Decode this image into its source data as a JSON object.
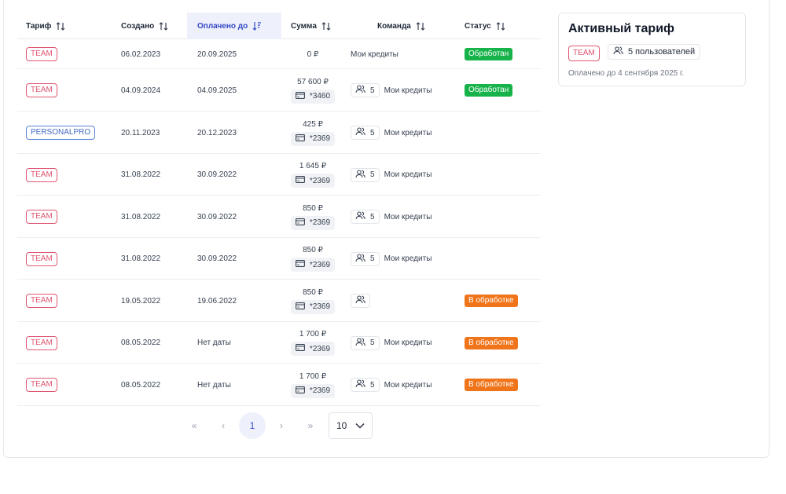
{
  "table": {
    "headers": {
      "tariff": "Тариф",
      "created": "Создано",
      "paid_until": "Оплачено до",
      "amount": "Сумма",
      "team": "Команда",
      "status": "Статус"
    },
    "rows": [
      {
        "tariff": "TEAM",
        "tariff_style": "team",
        "created": "06.02.2023",
        "paid_until": "20.09.2025",
        "amount": "0 ₽",
        "card": "",
        "team_count": "",
        "team_name": "Мои кредиты",
        "team_chip": false,
        "status": "Обработан",
        "status_color": "green"
      },
      {
        "tariff": "TEAM",
        "tariff_style": "team",
        "created": "04.09.2024",
        "paid_until": "04.09.2025",
        "amount": "57 600 ₽",
        "card": "*3460",
        "team_count": "5",
        "team_name": "Мои кредиты",
        "team_chip": true,
        "status": "Обработан",
        "status_color": "green"
      },
      {
        "tariff": "PERSONALPRO",
        "tariff_style": "pro",
        "created": "20.11.2023",
        "paid_until": "20.12.2023",
        "amount": "425 ₽",
        "card": "*2369",
        "team_count": "5",
        "team_name": "Мои кредиты",
        "team_chip": true,
        "status": "",
        "status_color": ""
      },
      {
        "tariff": "TEAM",
        "tariff_style": "team",
        "created": "31.08.2022",
        "paid_until": "30.09.2022",
        "amount": "1 645 ₽",
        "card": "*2369",
        "team_count": "5",
        "team_name": "Мои кредиты",
        "team_chip": true,
        "status": "",
        "status_color": ""
      },
      {
        "tariff": "TEAM",
        "tariff_style": "team",
        "created": "31.08.2022",
        "paid_until": "30.09.2022",
        "amount": "850 ₽",
        "card": "*2369",
        "team_count": "5",
        "team_name": "Мои кредиты",
        "team_chip": true,
        "status": "",
        "status_color": ""
      },
      {
        "tariff": "TEAM",
        "tariff_style": "team",
        "created": "31.08.2022",
        "paid_until": "30.09.2022",
        "amount": "850 ₽",
        "card": "*2369",
        "team_count": "5",
        "team_name": "Мои кредиты",
        "team_chip": true,
        "status": "",
        "status_color": ""
      },
      {
        "tariff": "TEAM",
        "tariff_style": "team",
        "created": "19.05.2022",
        "paid_until": "19.06.2022",
        "amount": "850 ₽",
        "card": "*2369",
        "team_count": "",
        "team_name": "",
        "team_chip": true,
        "status": "В обработке",
        "status_color": "orange"
      },
      {
        "tariff": "TEAM",
        "tariff_style": "team",
        "created": "08.05.2022",
        "paid_until": "Нет даты",
        "amount": "1 700 ₽",
        "card": "*2369",
        "team_count": "5",
        "team_name": "Мои кредиты",
        "team_chip": true,
        "status": "В обработке",
        "status_color": "orange"
      },
      {
        "tariff": "TEAM",
        "tariff_style": "team",
        "created": "08.05.2022",
        "paid_until": "Нет даты",
        "amount": "1 700 ₽",
        "card": "*2369",
        "team_count": "5",
        "team_name": "Мои кредиты",
        "team_chip": true,
        "status": "В обработке",
        "status_color": "orange"
      }
    ]
  },
  "pagination": {
    "first": "«",
    "prev": "‹",
    "current_page": "1",
    "next": "›",
    "last": "»",
    "page_size": "10"
  },
  "active_tariff": {
    "title": "Активный тариф",
    "tariff": "TEAM",
    "users": "5 пользователей",
    "paid_until": "Оплачено до 4 сентября 2025 г."
  },
  "colors": {
    "accent": "#3448c5",
    "team_badge": "#e05570",
    "pro_badge": "#4169c4",
    "status_green": "#16b24a",
    "status_orange": "#f0741a"
  },
  "icons": {
    "sort": "sort-icon",
    "sort_active": "sort-desc-icon",
    "card": "credit-card-icon",
    "team": "users-icon",
    "chevron": "chevron-down-icon"
  }
}
